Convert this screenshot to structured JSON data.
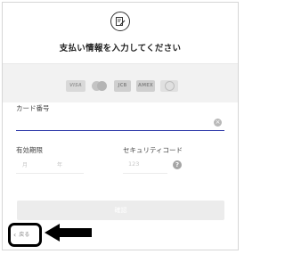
{
  "header": {
    "logo_icon": "edit-document-icon",
    "title": "支払い情報を入力してください"
  },
  "card_brands": [
    {
      "name": "VISA"
    },
    {
      "name": "Mastercard"
    },
    {
      "name": "JCB"
    },
    {
      "name": "AMEX"
    },
    {
      "name": "Diners"
    }
  ],
  "form": {
    "card_number_label": "カード番号",
    "card_number_value": "",
    "expiry_label": "有効期限",
    "expiry_month_placeholder": "月",
    "expiry_year_placeholder": "年",
    "security_code_label": "セキュリティコード",
    "security_code_placeholder": "123",
    "confirm_label": "確認"
  },
  "footer": {
    "back_label": "戻る"
  },
  "colors": {
    "input_underline": "#2b36a8",
    "annotation": "#000000"
  }
}
